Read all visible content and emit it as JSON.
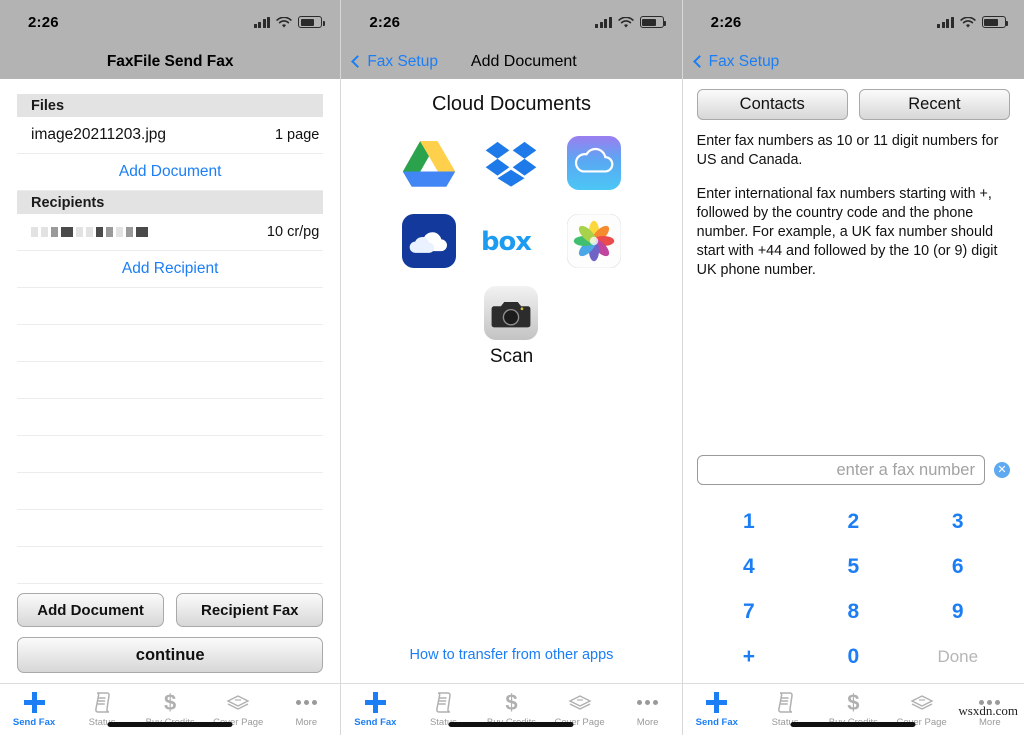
{
  "status_bar": {
    "time": "2:26",
    "signal_icon": "signal-bars-icon",
    "wifi_icon": "wifi-icon",
    "battery_icon": "battery-icon"
  },
  "panel1": {
    "nav_title": "FaxFile Send Fax",
    "sections": {
      "files_header": "Files",
      "recipients_header": "Recipients"
    },
    "file_row": {
      "name": "image20211203.jpg",
      "pages": "1 page"
    },
    "add_document_link": "Add Document",
    "recipient_row": {
      "name_redacted": "",
      "rate": "10 cr/pg"
    },
    "add_recipient_link": "Add Recipient",
    "buttons": {
      "add_document": "Add Document",
      "recipient_fax": "Recipient Fax",
      "continue": "continue"
    }
  },
  "panel2": {
    "back_label": "Fax Setup",
    "nav_title": "Add Document",
    "section_title": "Cloud Documents",
    "services": [
      {
        "label": "Google Drive",
        "icon": "google-drive-icon"
      },
      {
        "label": "Dropbox",
        "icon": "dropbox-icon"
      },
      {
        "label": "iCloud Drive",
        "icon": "icloud-icon"
      },
      {
        "label": "OneDrive",
        "icon": "onedrive-icon"
      },
      {
        "label": "Box",
        "icon": "box-icon"
      },
      {
        "label": "Photos",
        "icon": "photos-icon"
      }
    ],
    "scan": {
      "label": "Scan",
      "icon": "camera-icon"
    },
    "transfer_link": "How to transfer from other apps"
  },
  "panel3": {
    "back_label": "Fax Setup",
    "segments": {
      "contacts": "Contacts",
      "recent": "Recent"
    },
    "help_paragraph_1": "Enter fax numbers as 10 or 11 digit numbers for US and Canada.",
    "help_paragraph_2": "Enter international fax numbers starting with +, followed by the country code and the phone number. For example, a UK fax number should start with +44 and followed by the 10 (or 9) digit UK phone number.",
    "fax_input": {
      "value": "",
      "placeholder": "enter a fax number"
    },
    "clear_icon": "clear-circle-icon",
    "keypad": [
      "1",
      "2",
      "3",
      "4",
      "5",
      "6",
      "7",
      "8",
      "9",
      "+",
      "0",
      "Done"
    ]
  },
  "tabbar": {
    "items": [
      {
        "label": "Send Fax",
        "icon": "plus-icon",
        "active": true
      },
      {
        "label": "Status",
        "icon": "scroll-icon",
        "active": false
      },
      {
        "label": "Buy Credits",
        "icon": "dollar-icon",
        "active": false
      },
      {
        "label": "Cover Page",
        "icon": "stacked-pages-icon",
        "active": false
      },
      {
        "label": "More",
        "icon": "ellipsis-icon",
        "active": false
      }
    ]
  },
  "watermark": "wsxdn.com",
  "colors": {
    "accent": "#1b7ef5",
    "navbar": "#b3b3b3",
    "section_header": "#e3e3e3",
    "muted": "#9a9a9a"
  }
}
